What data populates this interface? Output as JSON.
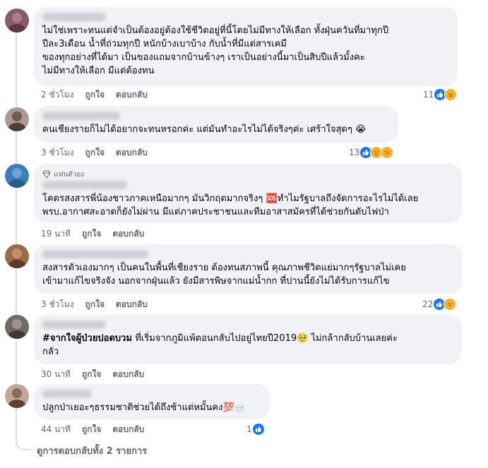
{
  "actions": {
    "like": "ถูกใจ",
    "reply": "ตอบกลับ"
  },
  "comments": [
    {
      "lines": [
        "ไม่ใช่เพราะทนแต่จำเป็นต้องอยู่ต้องใช้ชีวิตอยู่ที่นี้โดยไม่มีทางให้เลือก ทั้งฝุ่นควันที่มาทุกปี",
        "ปีละ3เดือน น้ำที่ถ่วมทุกปี หนักบ้างเบาบ้าง กับน้ำที่มีแต่สารเคมี",
        "ของทุกอย่างที่ได้มา เป็นของแถมจากบ้านข้างๆ เราเป็นอย่างนี้มาเป็นสิบปีแล้วมั้งคะ",
        "ไม่มีทางให้เลือก มีแต่ต้องทน"
      ],
      "time": "2 ชั่วโมง",
      "reaction_count": "11"
    },
    {
      "lines": [
        "คนเชียงรายก็ไม่ได้อยากจะทนหรอกค่ะ แต่มันทำอะไรไม่ได้จริงๆค่ะ เศร้าใจสุดๆ 😭"
      ],
      "time": "3 ชั่วโมง",
      "reaction_count": "13"
    },
    {
      "badge": "แฟนตัวยง",
      "lines": [
        "โคตรสงสารพี่น้องชาวภาคเหนือมากๆ มันวิกฤตมากจริงๆ 🆘ทำไมรัฐบาลถึงจัดการอะไรไม่ได้เลย",
        "พรบ.อากาศสะอาดก็ยังไม่ผ่าน มีแต่ภาคประชาชนและทีมอาสาสมัครที่ได้ช่วยกันดับไฟป่า"
      ],
      "time": "19 นาที"
    },
    {
      "lines": [
        "สงสารตัวเองมากๆ เป็นคนในพื้นที่เชียงราย ต้องทนสภาพนี้ คุณภาพชีวิตแย่มากๆรัฐบาลไม่เคย",
        "เข้ามาแก้ไขจริงจัง นอกจากฝุ่นแล้ว ยังมีสารพิษจากแม่น้ำกก ที่ปานนี้ยังไม่ได้รับการแก้ไข"
      ],
      "time": "3 ชั่วโมง",
      "reaction_count": "22"
    },
    {
      "hashtag": "#จากใจผู้ป่วยปอดบวม",
      "lines": [
        " ที่เริ่มจากภูมิแพ้ตอนกลับไปอยู่ไทยปี2019🥺 ไม่กล้ากลับบ้านเลยค่ะ",
        "กลัว"
      ],
      "time": "30 นาที"
    },
    {
      "lines": [
        "ปลูกป่าเยอะๆธรรมชาติช่วยได้ถึงช้าแต่หมั้นคง💯🌧️"
      ],
      "time": "44 นาที",
      "reaction_count": "1"
    }
  ],
  "see_all_replies": "ดูการตอบกลับทั้ง 2 รายการ"
}
